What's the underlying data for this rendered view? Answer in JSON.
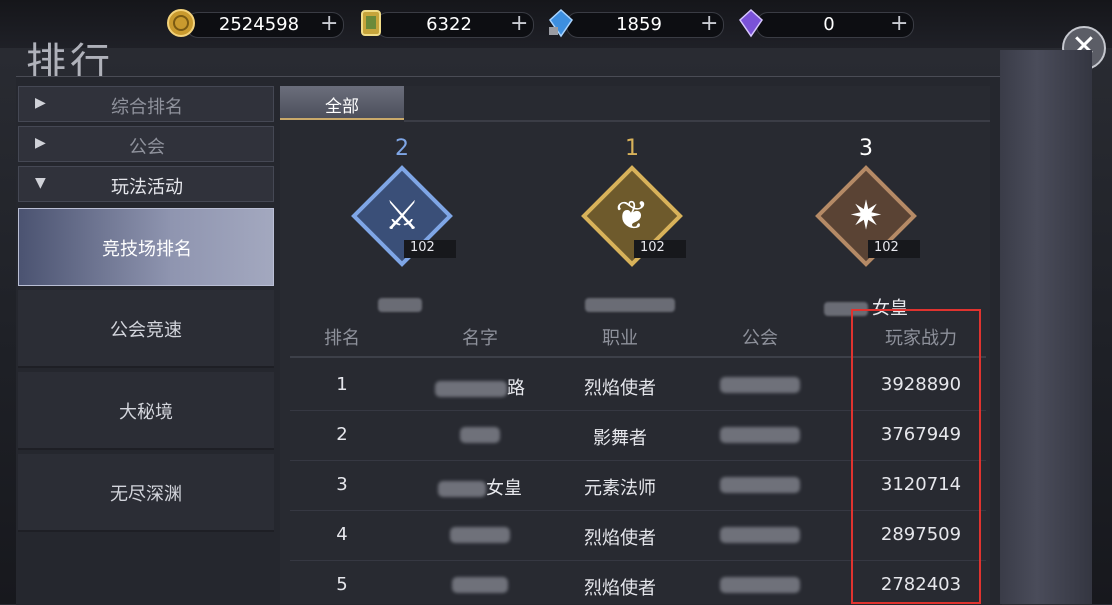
{
  "currencies": [
    {
      "icon": "gold-coin-icon",
      "value": "2524598",
      "plus": "+"
    },
    {
      "icon": "ticket-card-icon",
      "value": "6322",
      "plus": "+"
    },
    {
      "icon": "blue-crystal-locked-icon",
      "value": "1859",
      "plus": "+"
    },
    {
      "icon": "purple-crystal-icon",
      "value": "0",
      "plus": "+"
    }
  ],
  "title": "排行",
  "close_icon": "✕",
  "menu": {
    "heads": [
      {
        "label": "综合排名",
        "arrow": "▶"
      },
      {
        "label": "公会",
        "arrow": "▶"
      },
      {
        "label": "玩法活动",
        "arrow": "▼"
      }
    ],
    "subs": [
      "竞技场排名",
      "公会竞速",
      "大秘境",
      "无尽深渊"
    ]
  },
  "tab_all": "全部",
  "podium": [
    {
      "rank": "2",
      "level": "102",
      "name_suffix": "",
      "color": "#7fa6e6"
    },
    {
      "rank": "1",
      "level": "102",
      "name_suffix": "",
      "color": "#d8b25a"
    },
    {
      "rank": "3",
      "level": "102",
      "name_suffix": "女皇",
      "color": "#b58a66"
    }
  ],
  "table": {
    "headers": [
      "排名",
      "名字",
      "职业",
      "公会",
      "玩家战力"
    ],
    "rows": [
      {
        "rank": "1",
        "name_suffix": "路",
        "class": "烈焰使者",
        "power": "3928890"
      },
      {
        "rank": "2",
        "name_suffix": "",
        "class": "影舞者",
        "power": "3767949"
      },
      {
        "rank": "3",
        "name_suffix": "女皇",
        "class": "元素法师",
        "power": "3120714"
      },
      {
        "rank": "4",
        "name_suffix": "",
        "class": "烈焰使者",
        "power": "2897509"
      },
      {
        "rank": "5",
        "name_suffix": "",
        "class": "烈焰使者",
        "power": "2782403"
      }
    ]
  }
}
